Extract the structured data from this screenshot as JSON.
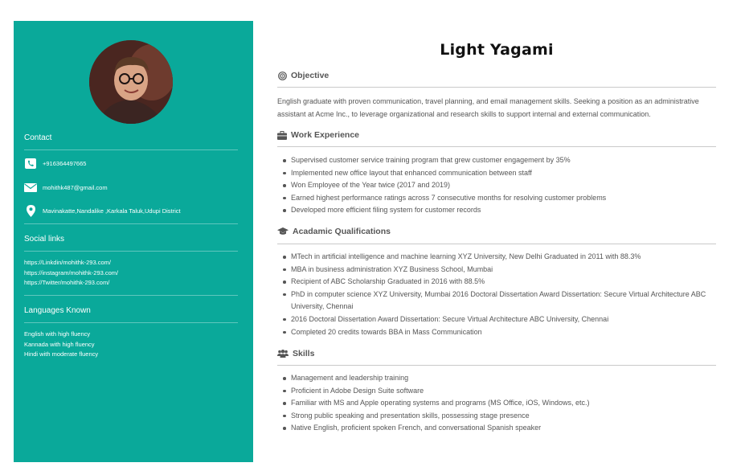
{
  "sidebar": {
    "contact_heading": "Contact",
    "phone": "+916364497665",
    "email": "mohithk487@gmail.com",
    "address": "Mavinakatte,Nandalike ,Karkala Taluk,Udupi District",
    "social_heading": "Social links",
    "social_links": [
      "https://Linkdin/mohithk-293.com/",
      "https://instagram/mohithk-293.com/",
      "https://Twitter/mohithk-293.com/"
    ],
    "languages_heading": "Languages Known",
    "languages": [
      "English with high fluency",
      "Kannada with high fluency",
      "Hindi with moderate fluency"
    ],
    "icons": {
      "phone": "phone-icon",
      "email": "envelope-icon",
      "address": "map-pin-icon"
    },
    "bg_color": "#0aa99a"
  },
  "main": {
    "name": "Light Yagami",
    "objective": {
      "title": "Objective",
      "icon": "target-icon",
      "line1": "English graduate with proven communication, travel planning, and email management skills. Seeking a position as an administrative",
      "line2": "assistant at Acme Inc., to leverage organizational and research skills to support internal and external communication."
    },
    "work": {
      "title": "Work Experience",
      "icon": "briefcase-icon",
      "items": [
        "Supervised customer service training program that grew customer engagement by 35%",
        "Implemented new office layout that enhanced communication between staff",
        "Won Employee of the Year twice (2017 and 2019)",
        "Earned highest performance ratings across 7 consecutive months for resolving customer problems",
        "Developed more efficient filing system for customer records"
      ]
    },
    "academic": {
      "title": "Acadamic Qualifications",
      "icon": "graduation-cap-icon",
      "items": [
        "MTech in artificial intelligence and machine learning XYZ University, New Delhi Graduated in 2011 with 88.3%",
        "MBA in business administration XYZ Business School, Mumbai",
        "Recipient of ABC Scholarship Graduated in 2016 with 88.5%",
        "PhD in computer science XYZ University, Mumbai 2016 Doctoral Dissertation Award Dissertation: Secure Virtual Architecture ABC University, Chennai",
        "2016 Doctoral Dissertation Award Dissertation: Secure Virtual Architecture ABC University, Chennai",
        "Completed 20 credits towards BBA in Mass Communication"
      ]
    },
    "skills": {
      "title": "Skills",
      "icon": "users-icon",
      "items": [
        "Management and leadership training",
        "Proficient in Adobe Design Suite software",
        "Familiar with MS and Apple operating systems and programs (MS Office, iOS, Windows, etc.)",
        "Strong public speaking and presentation skills, possessing stage presence",
        "Native English, proficient spoken French, and conversational Spanish speaker"
      ]
    }
  }
}
